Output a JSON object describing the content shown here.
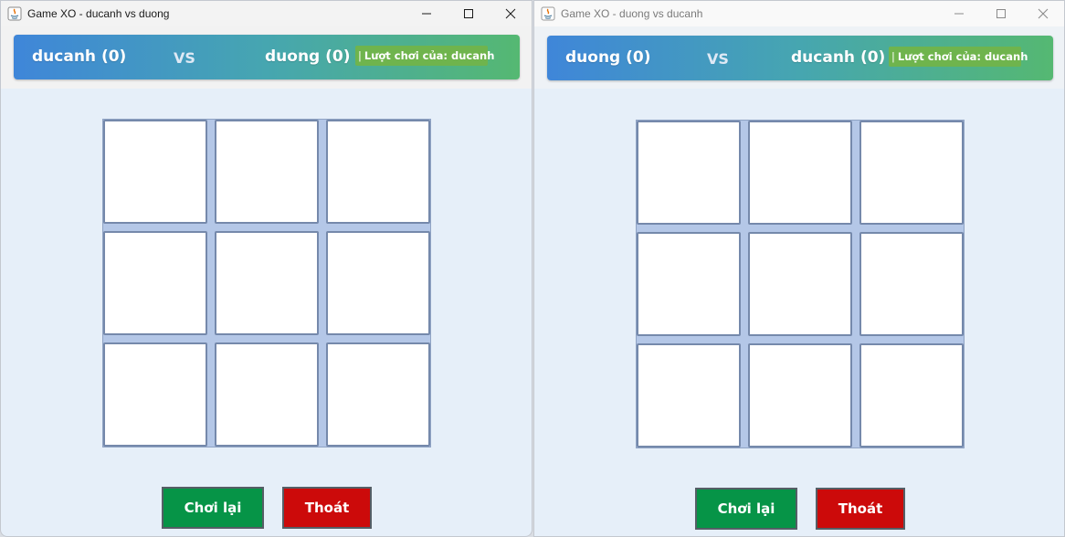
{
  "colors": {
    "header_gradient_start": "#3f86d9",
    "header_gradient_end": "#55b872",
    "turn_badge": "#6fb44d",
    "board_gap": "#b4c7e7",
    "cell_border": "#7589ab",
    "replay_button": "#069447",
    "quit_button": "#cc0a0a",
    "window_background": "#e6eff9"
  },
  "windows": [
    {
      "title": "Game XO - ducanh vs duong",
      "active": true,
      "controls": [
        "minimize-icon",
        "maximize-icon",
        "close-icon"
      ],
      "header": {
        "player1": "ducanh (0)",
        "vs": "VS",
        "player2": "duong (0)",
        "turn_sep": "|",
        "turn_label": "Lượt chơi của: ducanh"
      },
      "board": [
        "",
        "",
        "",
        "",
        "",
        "",
        "",
        "",
        ""
      ],
      "buttons": {
        "replay": "Chơi lại",
        "quit": "Thoát"
      }
    },
    {
      "title": "Game XO - duong vs ducanh",
      "active": false,
      "controls": [
        "minimize-icon",
        "maximize-icon",
        "close-icon"
      ],
      "header": {
        "player1": "duong (0)",
        "vs": "VS",
        "player2": "ducanh (0)",
        "turn_sep": "|",
        "turn_label": "Lượt chơi của: ducanh"
      },
      "board": [
        "",
        "",
        "",
        "",
        "",
        "",
        "",
        "",
        ""
      ],
      "buttons": {
        "replay": "Chơi lại",
        "quit": "Thoát"
      }
    }
  ]
}
